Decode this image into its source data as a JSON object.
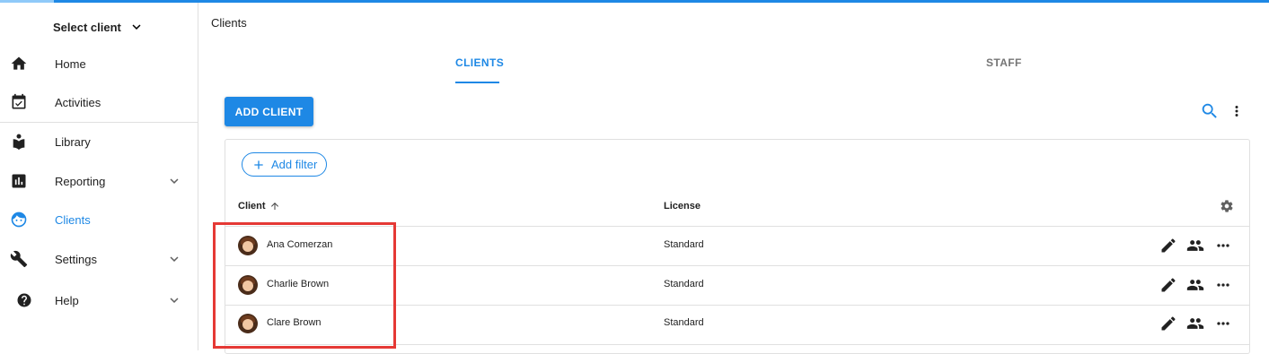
{
  "header": {
    "breadcrumb": "Clients"
  },
  "sidebar": {
    "client_select": "Select client",
    "items": [
      {
        "label": "Home",
        "icon": "home-icon",
        "active": false
      },
      {
        "label": "Activities",
        "icon": "calendar-check-icon",
        "active": false
      },
      {
        "label": "Library",
        "icon": "book-icon",
        "active": false
      },
      {
        "label": "Reporting",
        "icon": "bar-chart-icon",
        "active": false,
        "expandable": true
      },
      {
        "label": "Clients",
        "icon": "face-icon",
        "active": true
      },
      {
        "label": "Settings",
        "icon": "wrench-icon",
        "active": false,
        "expandable": true
      },
      {
        "label": "Help",
        "icon": "help-icon",
        "active": false,
        "expandable": true
      }
    ]
  },
  "tabs": [
    {
      "label": "CLIENTS",
      "active": true
    },
    {
      "label": "STAFF",
      "active": false
    }
  ],
  "toolbar": {
    "add_label": "ADD CLIENT"
  },
  "table": {
    "filter_label": "Add filter",
    "columns": {
      "client": "Client",
      "license": "License"
    },
    "rows": [
      {
        "name": "Ana Comerzan",
        "license": "Standard"
      },
      {
        "name": "Charlie Brown",
        "license": "Standard"
      },
      {
        "name": "Clare Brown",
        "license": "Standard"
      }
    ]
  },
  "colors": {
    "accent": "#1e88e5",
    "highlight": "#e53935"
  }
}
